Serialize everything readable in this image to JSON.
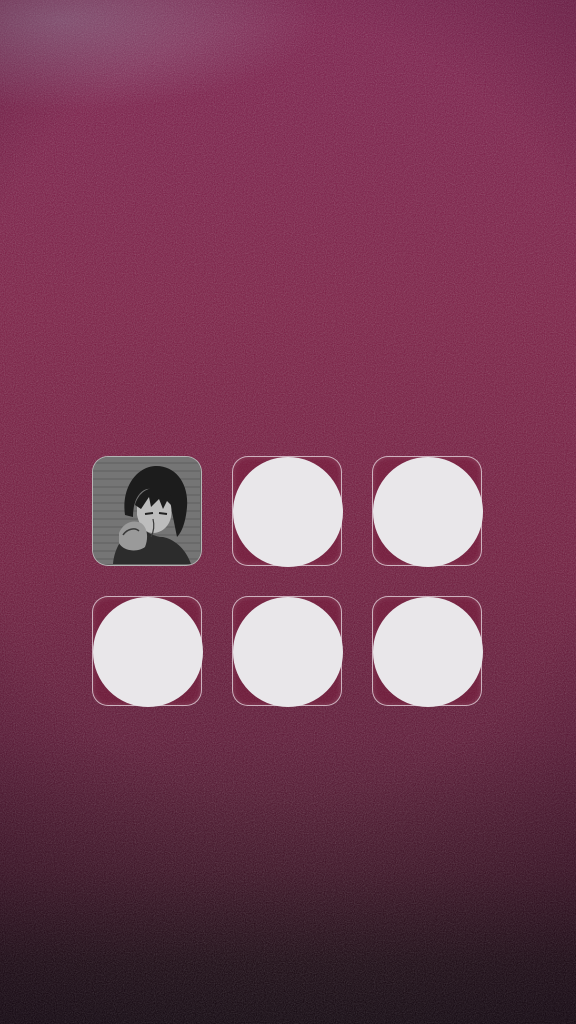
{
  "screen": {
    "background_colors": [
      "#7a1848",
      "#5a1030",
      "#0a0206"
    ]
  },
  "widget_grid": {
    "rows": 2,
    "columns": 3,
    "slots": [
      {
        "content": "anime-girl-photo",
        "style": "grayscale"
      },
      {
        "content": "blank-circle",
        "color": "#e9e7ea"
      },
      {
        "content": "blank-circle",
        "color": "#e9e7ea"
      },
      {
        "content": "blank-circle",
        "color": "#e9e7ea"
      },
      {
        "content": "blank-circle",
        "color": "#e9e7ea"
      },
      {
        "content": "blank-circle",
        "color": "#e9e7ea"
      }
    ]
  }
}
